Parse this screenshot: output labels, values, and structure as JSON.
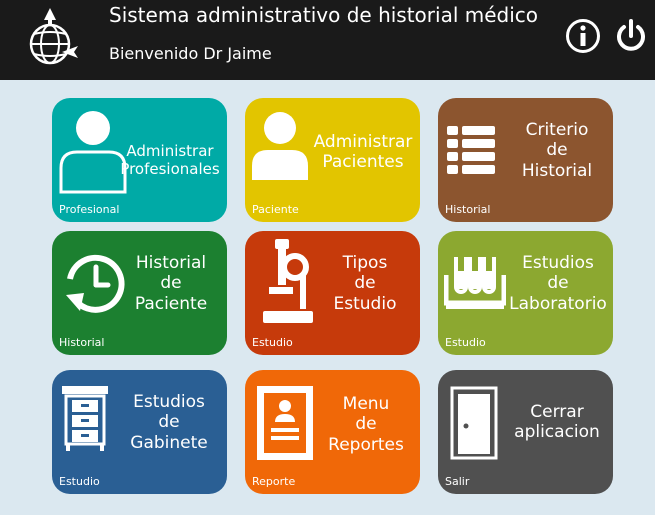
{
  "header": {
    "title": "Sistema administrativo de historial médico",
    "welcome": "Bienvenido Dr Jaime",
    "logo_icon": "globe-airplane-icon",
    "info_icon": "info-icon",
    "power_icon": "power-icon"
  },
  "tiles": [
    {
      "title": "Administrar\nProfesionales",
      "subtitle": "Profesional",
      "icon": "user-icon",
      "color": "#00aaa6"
    },
    {
      "title": "Administrar\nPacientes",
      "subtitle": "Paciente",
      "icon": "user-icon",
      "color": "#e2c500"
    },
    {
      "title": "Criterio\nde\nHistorial",
      "subtitle": "Historial",
      "icon": "list-icon",
      "color": "#8c552f"
    },
    {
      "title": "Historial\nde\nPaciente",
      "subtitle": "Historial",
      "icon": "clock-history-icon",
      "color": "#1c8030"
    },
    {
      "title": "Tipos\nde\nEstudio",
      "subtitle": "Estudio",
      "icon": "microscope-icon",
      "color": "#c63a0b"
    },
    {
      "title": "Estudios\nde\nLaboratorio",
      "subtitle": "Estudio",
      "icon": "test-tubes-icon",
      "color": "#8ca830"
    },
    {
      "title": "Estudios\nde\nGabinete",
      "subtitle": "Estudio",
      "icon": "cabinet-icon",
      "color": "#2a5f94"
    },
    {
      "title": "Menu\nde\nReportes",
      "subtitle": "Reporte",
      "icon": "report-icon",
      "color": "#f06808"
    },
    {
      "title": "Cerrar\naplicacion",
      "subtitle": "Salir",
      "icon": "door-icon",
      "color": "#505050"
    }
  ]
}
